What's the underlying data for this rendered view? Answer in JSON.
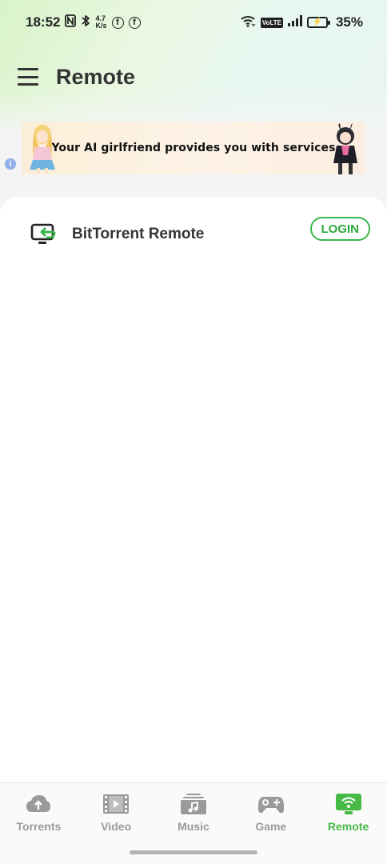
{
  "status_bar": {
    "time": "18:52",
    "nfc_icon": "N",
    "bluetooth_icon": "bluetooth",
    "speed_value": "4.7",
    "speed_unit": "K/s",
    "fb1": "f",
    "fb2": "f",
    "volte": "VoLTE",
    "battery_percent": "35%"
  },
  "header": {
    "title": "Remote",
    "menu_icon": "hamburger-menu-icon"
  },
  "ad": {
    "text": "Your AI girlfriend provides you with services",
    "info_icon": "i"
  },
  "remote_item": {
    "label": "BitTorrent Remote",
    "login_label": "LOGIN",
    "icon": "monitor-sync-icon"
  },
  "bottom_nav": {
    "items": [
      {
        "label": "Torrents",
        "icon": "cloud-upload-icon",
        "active": false
      },
      {
        "label": "Video",
        "icon": "film-icon",
        "active": false
      },
      {
        "label": "Music",
        "icon": "music-folder-icon",
        "active": false
      },
      {
        "label": "Game",
        "icon": "gamepad-icon",
        "active": false
      },
      {
        "label": "Remote",
        "icon": "remote-wifi-icon",
        "active": true
      }
    ]
  },
  "colors": {
    "accent": "#46b947",
    "inactive": "#9a9a9a",
    "title_text": "#333333"
  }
}
